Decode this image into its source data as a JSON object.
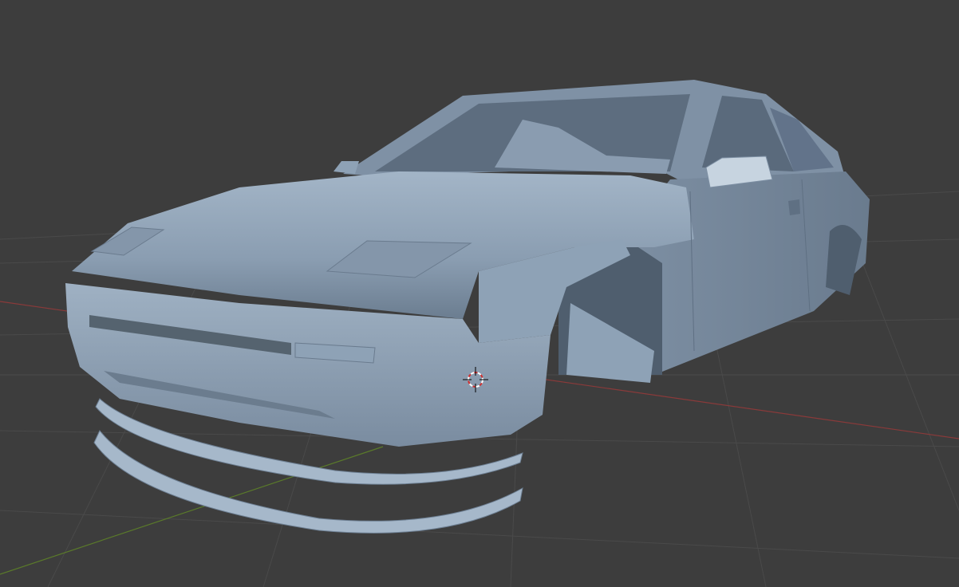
{
  "viewport": {
    "background": "#3d3d3d",
    "grid_color": "#4a4a4a",
    "x_axis_color": "#8a3a3a",
    "y_axis_color": "#5a7a2a",
    "model_color": "#8ea2b6",
    "model_shadow": "#5f7083",
    "model_highlight": "#b3c4d4",
    "cursor_icon": "3d-cursor-icon"
  }
}
